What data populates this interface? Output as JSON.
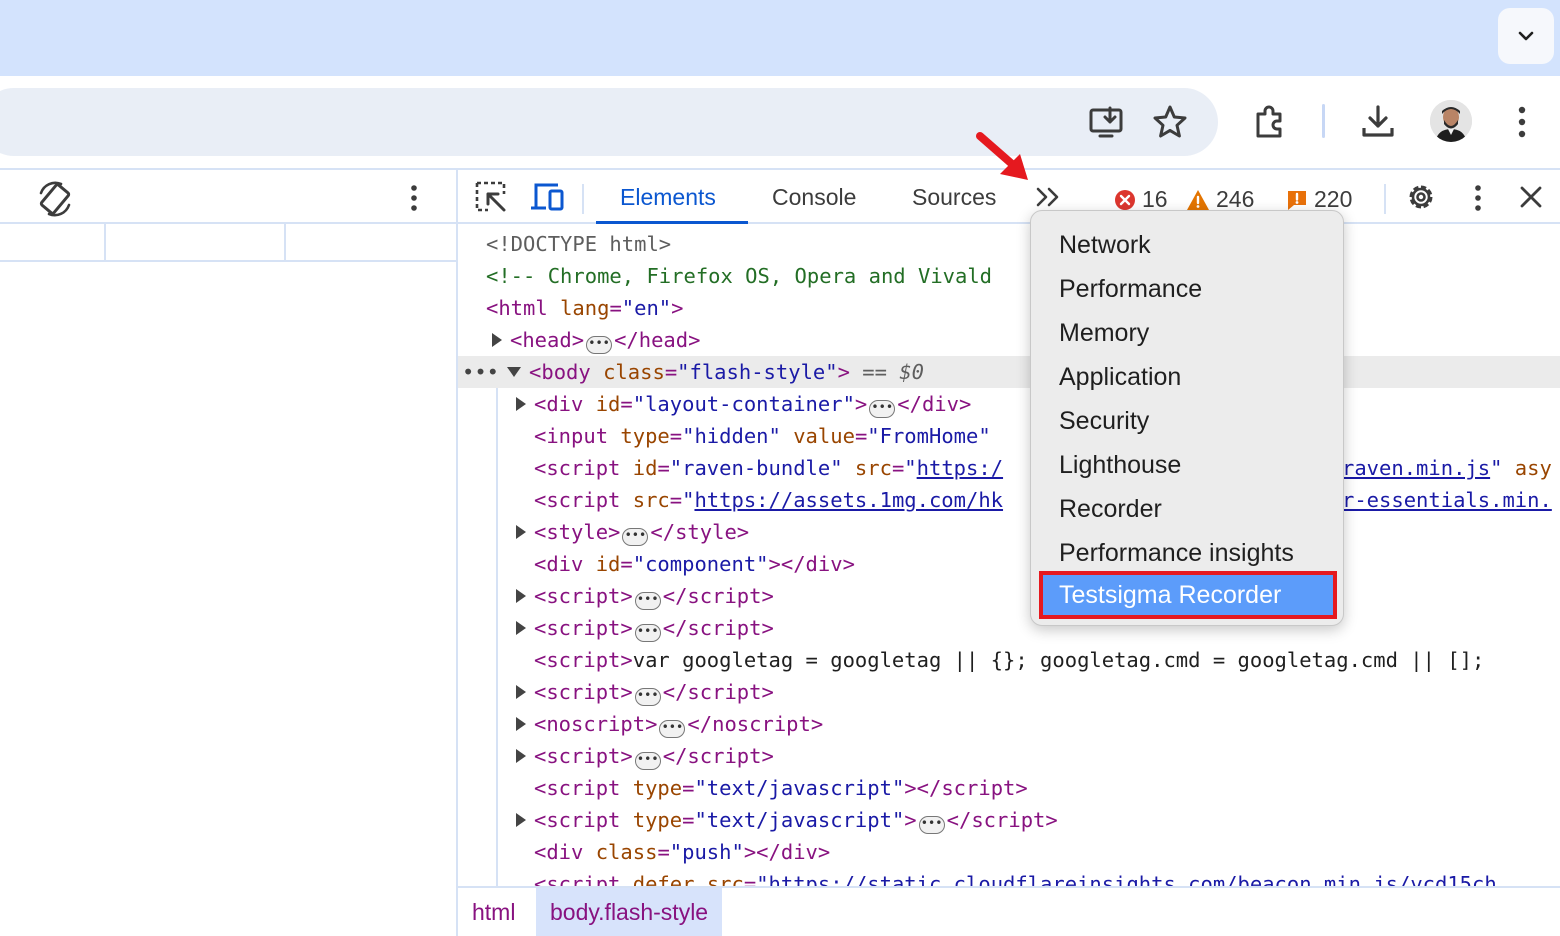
{
  "devtools": {
    "tabs": [
      {
        "label": "Elements",
        "active": true
      },
      {
        "label": "Console"
      },
      {
        "label": "Sources"
      }
    ],
    "errors": "16",
    "warnings": "246",
    "issues": "220",
    "accent_color": "#0b57d0"
  },
  "dom": {
    "doctype": "<!DOCTYPE html>",
    "comment": "<!-- Chrome, Firefox OS, Opera and Vivald",
    "selected_marker": "== $0",
    "link_raven_a": "https:/",
    "link_raven_b": "raven.min.js",
    "link_assets_a": "https://assets.1mg.com/hk",
    "link_assets_b": "r-essentials.min.",
    "googletag": "var googletag = googletag || {}; googletag.cmd = googletag.cmd || [];",
    "cloudflare": "https://static.cloudflareinsights.com/beacon.min.js/vcd15ch"
  },
  "menu": {
    "items": [
      "Network",
      "Performance",
      "Memory",
      "Application",
      "Security",
      "Lighthouse",
      "Recorder",
      "Performance insights"
    ],
    "highlighted": "Testsigma Recorder",
    "highlight_color": "#5c9cfa",
    "frame_color": "#e5191f"
  },
  "breadcrumbs": [
    "html",
    "body.flash-style"
  ],
  "icons": {
    "tab_search": "chevron-down-icon",
    "install": "install-app-icon",
    "bookmark": "star-icon",
    "extensions": "puzzle-icon",
    "downloads": "download-icon",
    "browser_menu": "kebab-icon",
    "rotate": "rotate-device-icon",
    "inspect": "inspect-element-icon",
    "device": "device-toolbar-icon",
    "more_tabs": "double-chevron-icon",
    "settings": "gear-icon",
    "close": "close-icon",
    "annotation_arrow": "red-arrow-icon"
  }
}
